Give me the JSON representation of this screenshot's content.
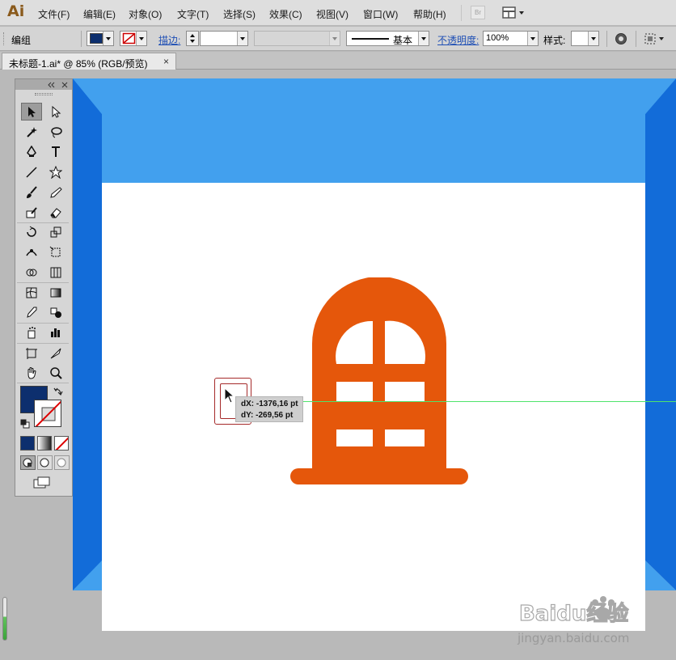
{
  "app": {
    "logo": "Ai"
  },
  "menu": [
    "文件(F)",
    "编辑(E)",
    "对象(O)",
    "文字(T)",
    "选择(S)",
    "效果(C)",
    "视图(V)",
    "窗口(W)",
    "帮助(H)"
  ],
  "menubar": {
    "bridge_label": "Br"
  },
  "control_bar": {
    "selection_label": "编组",
    "stroke_label": "描边:",
    "stroke_profile": "基本",
    "opacity_label": "不透明度:",
    "opacity_value": "100%",
    "style_label": "样式:"
  },
  "document": {
    "tab_title": "未标题-1.ai* @ 85% (RGB/预览)",
    "close_glyph": "×"
  },
  "tooltip": {
    "dx": "dX: -1376,16 pt",
    "dy": "dY: -269,56 pt"
  },
  "watermark": {
    "brand": "Baidu经验",
    "url": "jingyan.baidu.com"
  },
  "colors": {
    "fill": "#0d2f6e",
    "window_shape": "#e5570b",
    "frame_light": "#42a0ee",
    "frame_dark": "#126cd9",
    "guide": "#4fe36b",
    "selection": "#a52a2a"
  },
  "tools": [
    "selection-tool",
    "direct-selection-tool",
    "magic-wand-tool",
    "lasso-tool",
    "pen-tool",
    "type-tool",
    "line-segment-tool",
    "star-tool",
    "paintbrush-tool",
    "pencil-tool",
    "blob-brush-tool",
    "eraser-tool",
    "rotate-tool",
    "scale-tool",
    "width-tool",
    "free-transform-tool",
    "shape-builder-tool",
    "graph-tool",
    "mesh-tool",
    "gradient-tool",
    "eyedropper-tool",
    "blend-tool",
    "symbol-sprayer-tool",
    "column-graph-tool",
    "artboard-tool",
    "slice-tool",
    "hand-tool",
    "zoom-tool"
  ]
}
